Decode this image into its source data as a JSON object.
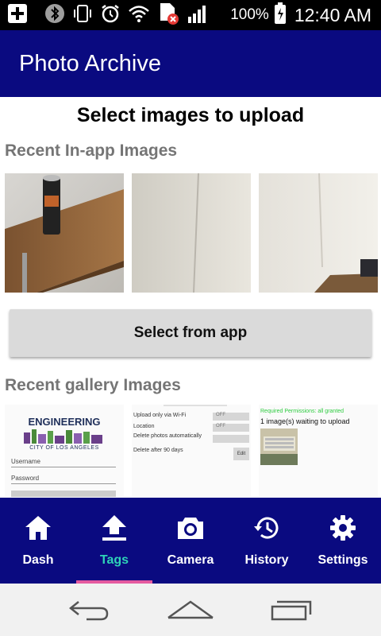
{
  "status_bar": {
    "battery_percent": "100%",
    "time": "12:40 AM",
    "icons": [
      "add-icon",
      "bluetooth-icon",
      "vibrate-icon",
      "alarm-icon",
      "wifi-icon",
      "sim-error-icon",
      "signal-icon",
      "battery-icon"
    ]
  },
  "app_bar": {
    "title": "Photo Archive"
  },
  "page": {
    "heading": "Select images to upload",
    "recent_in_app_title": "Recent In-app Images",
    "select_from_app_label": "Select from app",
    "recent_gallery_title": "Recent gallery Images"
  },
  "gallery": {
    "login": {
      "logo_text": "ENGINEERING",
      "logo_sub": "CITY OF LOS ANGELES",
      "username_label": "Username",
      "password_label": "Password"
    },
    "settings": {
      "rows": [
        {
          "label": "Upload only via Wi-Fi",
          "value": "OFF"
        },
        {
          "label": "Location",
          "value": "OFF"
        },
        {
          "label": "Delete photos automatically",
          "value": ""
        }
      ],
      "delete_after": "Delete after 90 days",
      "edit_label": "Edit"
    },
    "queue": {
      "permissions_text": "Required Permissions: all granted",
      "waiting_text": "1 image(s) waiting to upload"
    }
  },
  "bottom_nav": {
    "items": [
      {
        "label": "Dash",
        "icon": "home-icon"
      },
      {
        "label": "Tags",
        "icon": "upload-icon",
        "active": true
      },
      {
        "label": "Camera",
        "icon": "camera-icon"
      },
      {
        "label": "History",
        "icon": "history-icon"
      },
      {
        "label": "Settings",
        "icon": "gear-icon"
      }
    ]
  },
  "system_nav": {
    "icons": [
      "back-icon",
      "home-nav-icon",
      "recents-icon"
    ]
  },
  "colors": {
    "primary": "#0a0a80",
    "active_label": "#2ed3b7",
    "active_indicator": "#e55aa0",
    "section_title": "#757575",
    "button_bg": "#dadada"
  }
}
